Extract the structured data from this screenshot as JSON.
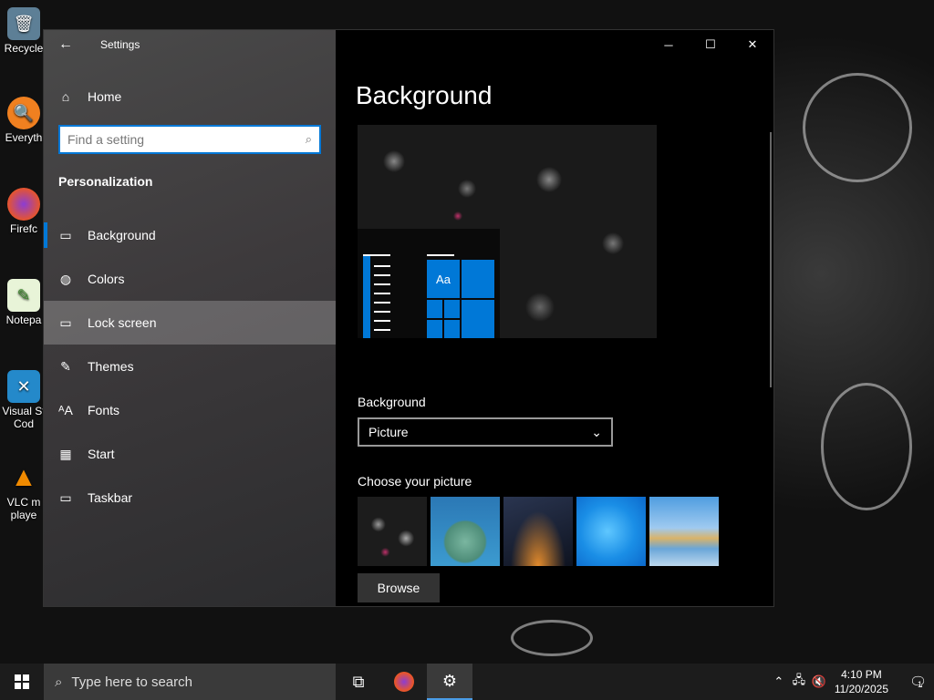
{
  "desktop": {
    "icons": [
      {
        "label": "Recycle",
        "icon": "recycle-bin-icon",
        "color": "#6b8fa8"
      },
      {
        "label": "Everyth",
        "icon": "everything-search-icon",
        "color": "#f08020"
      },
      {
        "label": "Firefc",
        "icon": "firefox-icon",
        "color": "#e8552a"
      },
      {
        "label": "Notepa",
        "icon": "notepad-plus-icon",
        "color": "#8cc63f"
      },
      {
        "label": "Visual St Cod",
        "icon": "vscode-icon",
        "color": "#2489ca"
      },
      {
        "label": "VLC m playe",
        "icon": "vlc-icon",
        "color": "#f08a00"
      }
    ]
  },
  "window": {
    "title": "Settings",
    "back_icon": "back-arrow-icon",
    "controls": {
      "minimize": "─",
      "maximize": "☐",
      "close": "✕"
    }
  },
  "sidebar": {
    "home_label": "Home",
    "search_placeholder": "Find a setting",
    "section_title": "Personalization",
    "items": [
      {
        "label": "Background",
        "icon": "picture-icon",
        "glyph": "▭"
      },
      {
        "label": "Colors",
        "icon": "palette-icon",
        "glyph": "◍"
      },
      {
        "label": "Lock screen",
        "icon": "lock-screen-icon",
        "glyph": "▭"
      },
      {
        "label": "Themes",
        "icon": "themes-icon",
        "glyph": "✎"
      },
      {
        "label": "Fonts",
        "icon": "fonts-icon",
        "glyph": "ᴬA"
      },
      {
        "label": "Start",
        "icon": "start-tiles-icon",
        "glyph": "▦"
      },
      {
        "label": "Taskbar",
        "icon": "taskbar-icon",
        "glyph": "▭"
      }
    ],
    "active_item": "Background",
    "hovered_item": "Lock screen"
  },
  "main": {
    "title": "Background",
    "preview": {
      "sample_text": "Aa"
    },
    "background_label": "Background",
    "background_value": "Picture",
    "choose_label": "Choose your picture",
    "browse_label": "Browse"
  },
  "taskbar": {
    "search_placeholder": "Type here to search",
    "time": "4:10 PM",
    "date": "11/20/2025",
    "notification_count": "1",
    "accent": "#0078d7"
  }
}
